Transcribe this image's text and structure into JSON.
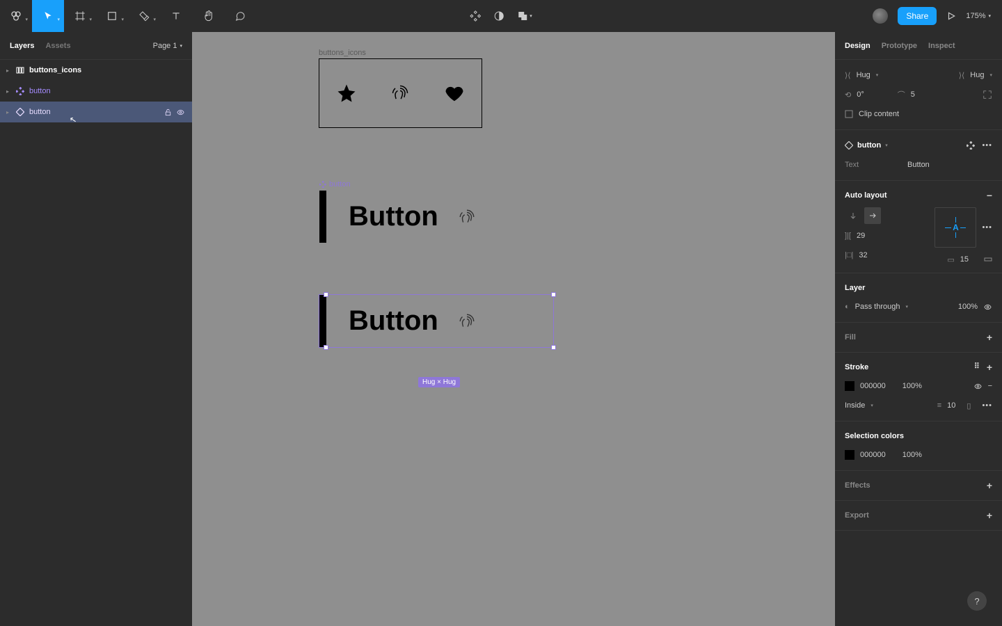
{
  "toolbar": {
    "share_label": "Share",
    "zoom": "175%"
  },
  "left_panel": {
    "tabs": {
      "layers": "Layers",
      "assets": "Assets"
    },
    "page": "Page 1",
    "layers": [
      {
        "name": "buttons_icons"
      },
      {
        "name": "button"
      },
      {
        "name": "button"
      }
    ]
  },
  "canvas": {
    "frame_label": "buttons_icons",
    "button_comp_label": "button",
    "button_text": "Button",
    "selection_badge": "Hug × Hug"
  },
  "right_panel": {
    "tabs": {
      "design": "Design",
      "prototype": "Prototype",
      "inspect": "Inspect"
    },
    "size": {
      "w": "Hug",
      "h": "Hug",
      "rotation": "0°",
      "radius": "5",
      "clip": "Clip content"
    },
    "component": {
      "name": "button",
      "text_label": "Text",
      "text_value": "Button"
    },
    "auto_layout": {
      "title": "Auto layout",
      "spacing": "29",
      "padding_h": "32",
      "padding_v": "15"
    },
    "layer": {
      "title": "Layer",
      "blend": "Pass through",
      "opacity": "100%"
    },
    "fill": {
      "title": "Fill"
    },
    "stroke": {
      "title": "Stroke",
      "color": "000000",
      "opacity": "100%",
      "position": "Inside",
      "weight": "10"
    },
    "selection_colors": {
      "title": "Selection colors",
      "color": "000000",
      "opacity": "100%"
    },
    "effects": {
      "title": "Effects"
    },
    "export": {
      "title": "Export"
    }
  }
}
